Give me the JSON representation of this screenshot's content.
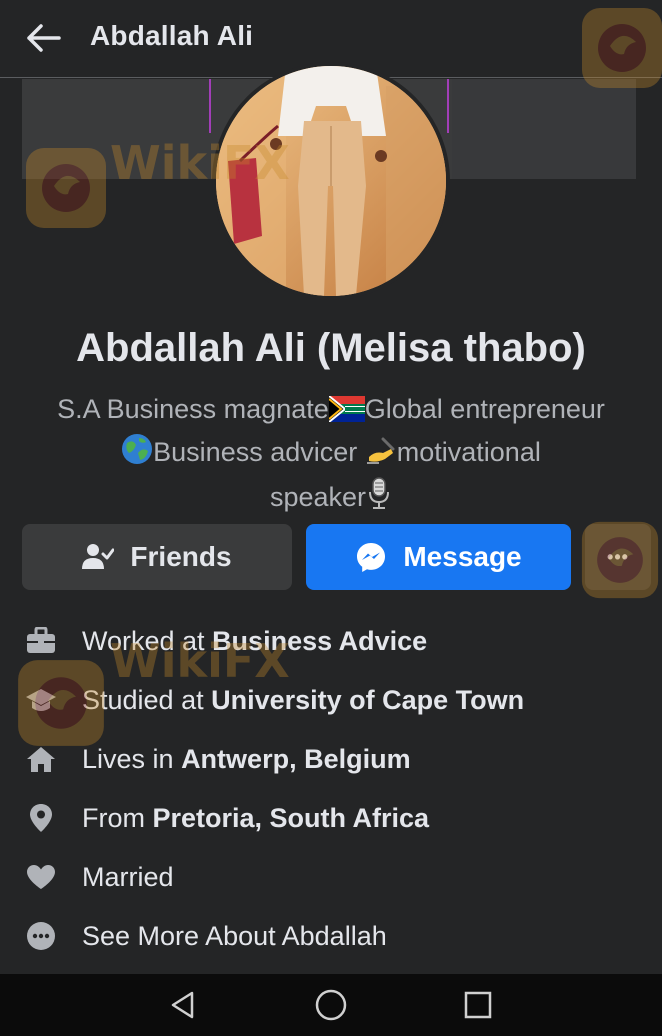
{
  "header": {
    "title": "Abdallah Ali"
  },
  "profile": {
    "name": "Abdallah Ali (Melisa thabo)",
    "bio_line1_a": "S.A Business magnate",
    "bio_line1_b": "Global entrepreneur",
    "bio_line2_a": "Business advicer ",
    "bio_line2_b": "motivational",
    "bio_line3": "speaker"
  },
  "actions": {
    "friends_label": "Friends",
    "message_label": "Message",
    "more_label": "•••"
  },
  "details": [
    {
      "icon": "briefcase-icon",
      "prefix": "Worked at ",
      "value": "Business Advice"
    },
    {
      "icon": "graduation-cap-icon",
      "prefix": "Studied at ",
      "value": "University of Cape Town"
    },
    {
      "icon": "home-icon",
      "prefix": "Lives in ",
      "value": "Antwerp, Belgium"
    },
    {
      "icon": "location-pin-icon",
      "prefix": "From ",
      "value": "Pretoria, South Africa"
    },
    {
      "icon": "heart-icon",
      "prefix": "Married",
      "value": ""
    },
    {
      "icon": "more-dots-icon",
      "prefix": "See More About Abdallah",
      "value": ""
    }
  ],
  "watermark": {
    "text": "WikiFX"
  },
  "colors": {
    "background": "#242526",
    "accent": "#1877f2",
    "button_secondary": "#3a3b3c",
    "text_primary": "#e4e6eb",
    "text_secondary": "#b0b3b8"
  }
}
